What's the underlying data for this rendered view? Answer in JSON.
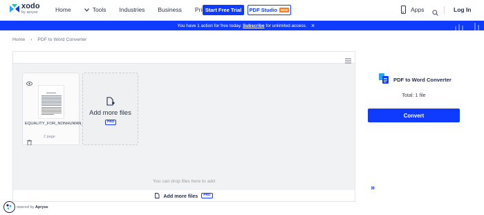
{
  "header": {
    "logo_name": "xodo",
    "logo_by": "by apryse",
    "nav": [
      {
        "label": "Home"
      },
      {
        "label": "Tools"
      },
      {
        "label": "Industries"
      },
      {
        "label": "Business"
      },
      {
        "label": "Pricing"
      }
    ],
    "trial_label": "Start Free Trial",
    "studio_label": "PDF Studio",
    "new_badge": "NEW",
    "apps_label": "Apps",
    "login_label": "Log In"
  },
  "banner": {
    "text_before": "You have 1 action for free today.",
    "link": "Subscribe",
    "text_after": "for unlimited access.",
    "close": "×"
  },
  "breadcrumb": {
    "home": "Home",
    "sep": "›",
    "current": "PDF to Word Converter"
  },
  "workspace": {
    "file": {
      "name": "EQUALITY_FOR_NONHUMAN_ANIMAL.pdf",
      "pages": "2 page"
    },
    "add_card_label": "Add more files",
    "pro": "PRO",
    "drop_hint": "You can drop files here to add",
    "footer_label": "Add more files"
  },
  "panel": {
    "title": "PDF to Word Converter",
    "total": "Total: 1 file",
    "convert_label": "Convert",
    "expand": "»"
  },
  "powered": {
    "prefix": "owered by",
    "brand": "Apryse"
  },
  "colors": {
    "accent": "#0f3bff",
    "text_dark": "#1f2b48",
    "workspace_bg": "#f1f2f4"
  }
}
